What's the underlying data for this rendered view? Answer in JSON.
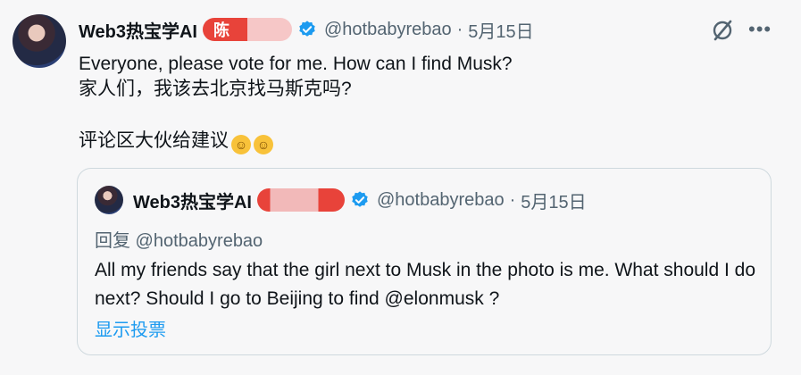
{
  "post": {
    "author_name": "Web3热宝学AI",
    "badge_text": "陈",
    "handle": "@hotbabyrebao",
    "separator": "·",
    "date": "5月15日",
    "line1": "Everyone, please vote for me. How can I find Musk?",
    "line2": "家人们，我该去北京找马斯克吗?",
    "line3": "评论区大伙给建议"
  },
  "quoted": {
    "author_name": "Web3热宝学AI",
    "handle": "@hotbabyrebao",
    "separator": "·",
    "date": "5月15日",
    "replying_to": "回复 @hotbabyrebao",
    "body": "All my friends say that the girl next to Musk in the photo is me. What should I do next? Should I go to Beijing to find @elonmusk ?",
    "show_poll": "显示投票"
  },
  "icons": {
    "verified": "verified-badge-icon",
    "grok": "grok-icon",
    "more": "more-icon",
    "emoji": "rolling-laughing-emoji"
  },
  "colors": {
    "accent": "#1d9bf0",
    "text_secondary": "#536471",
    "badge_red": "#e8433a"
  }
}
